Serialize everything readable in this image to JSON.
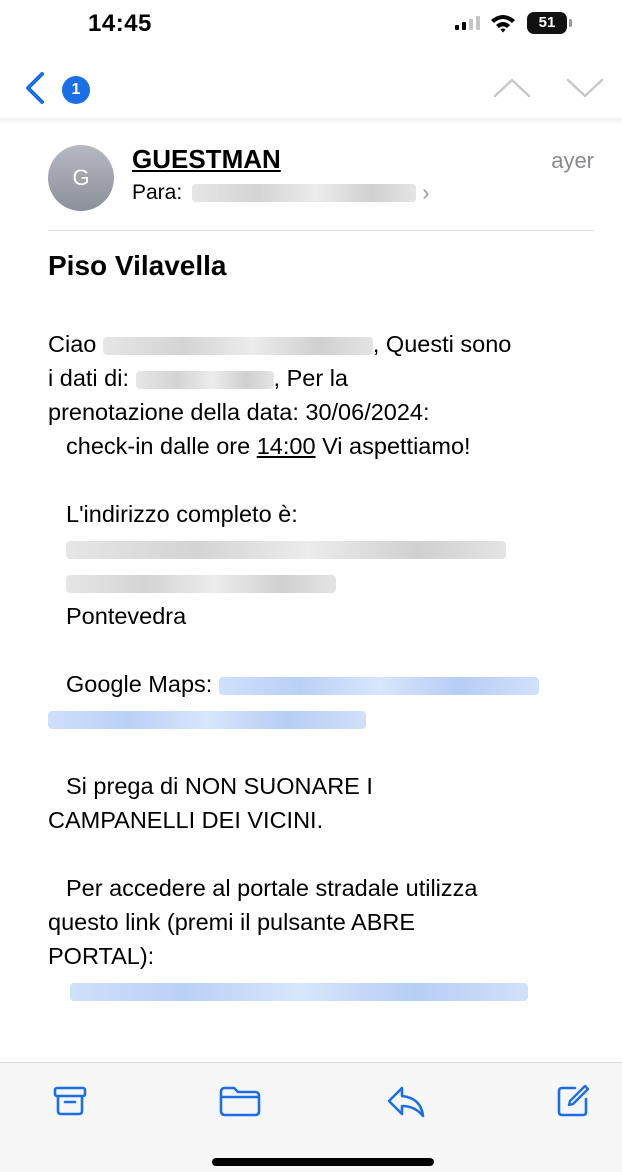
{
  "status_bar": {
    "time": "14:45",
    "battery_level": "51",
    "signal_bars_active": 2,
    "signal_bars_total": 4
  },
  "nav": {
    "unread_count": "1",
    "back_icon": "chevron-left-icon",
    "prev_icon": "chevron-up-icon",
    "next_icon": "chevron-down-icon"
  },
  "header": {
    "avatar_initial": "G",
    "sender": "GUESTMAN",
    "date": "ayer",
    "to_label": "Para:",
    "chevron": "›"
  },
  "email": {
    "subject": "Piso Vilavella",
    "greeting_start": "Ciao",
    "greeting_end": ", Questi sono",
    "data_di": "i dati di:",
    "per_la": ", Per la",
    "prenotazione": "prenotazione della data: 30/06/2024:",
    "checkin_before": "check-in dalle ore",
    "checkin_time": "14:00",
    "checkin_after": "Vi aspettiamo!",
    "address_label": "L'indirizzo completo è:",
    "address_city": "Pontevedra",
    "maps_label": "Google Maps:",
    "notice_line1": "Si prega di NON SUONARE I",
    "notice_line2": "CAMPANELLI DEI VICINI.",
    "portal_line1": "Per accedere al portale stradale utilizza",
    "portal_line2": "questo link (premi il pulsante ABRE",
    "portal_line3": "PORTAL):"
  },
  "toolbar": {
    "archive_icon": "archive-icon",
    "folder_icon": "folder-icon",
    "reply_icon": "reply-icon",
    "compose_icon": "compose-icon"
  },
  "colors": {
    "accent": "#1b6fe6",
    "date_gray": "#8a8a8e",
    "link_blur": "#b9d0f6"
  }
}
